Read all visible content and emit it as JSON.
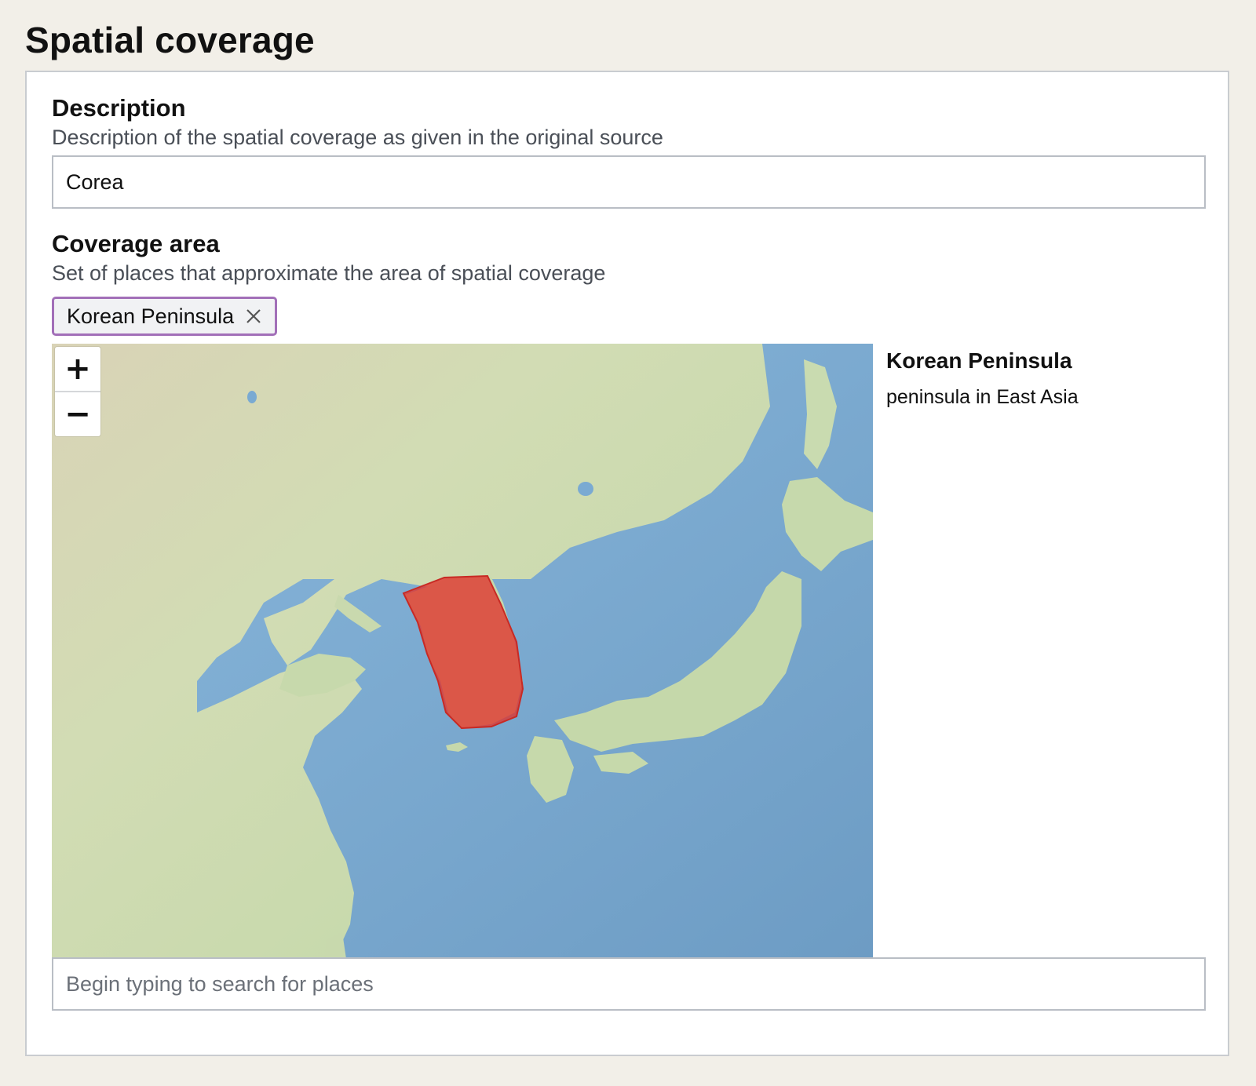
{
  "page_title": "Spatial coverage",
  "description_field": {
    "label": "Description",
    "help": "Description of the spatial coverage as given in the original source",
    "value": "Corea"
  },
  "coverage_field": {
    "label": "Coverage area",
    "help": "Set of places that approximate the area of spatial coverage",
    "selected_places": [
      {
        "label": "Korean Peninsula",
        "remove_icon": "close-icon"
      }
    ],
    "search_placeholder": "Begin typing to search for places"
  },
  "map": {
    "zoom_in_label": "+",
    "zoom_out_label": "−",
    "highlight_color": "#e0322b",
    "land_color": "#c9dcb0",
    "water_color": "#86b2d6"
  },
  "place_info": {
    "name": "Korean Peninsula",
    "description": "peninsula in East Asia"
  }
}
